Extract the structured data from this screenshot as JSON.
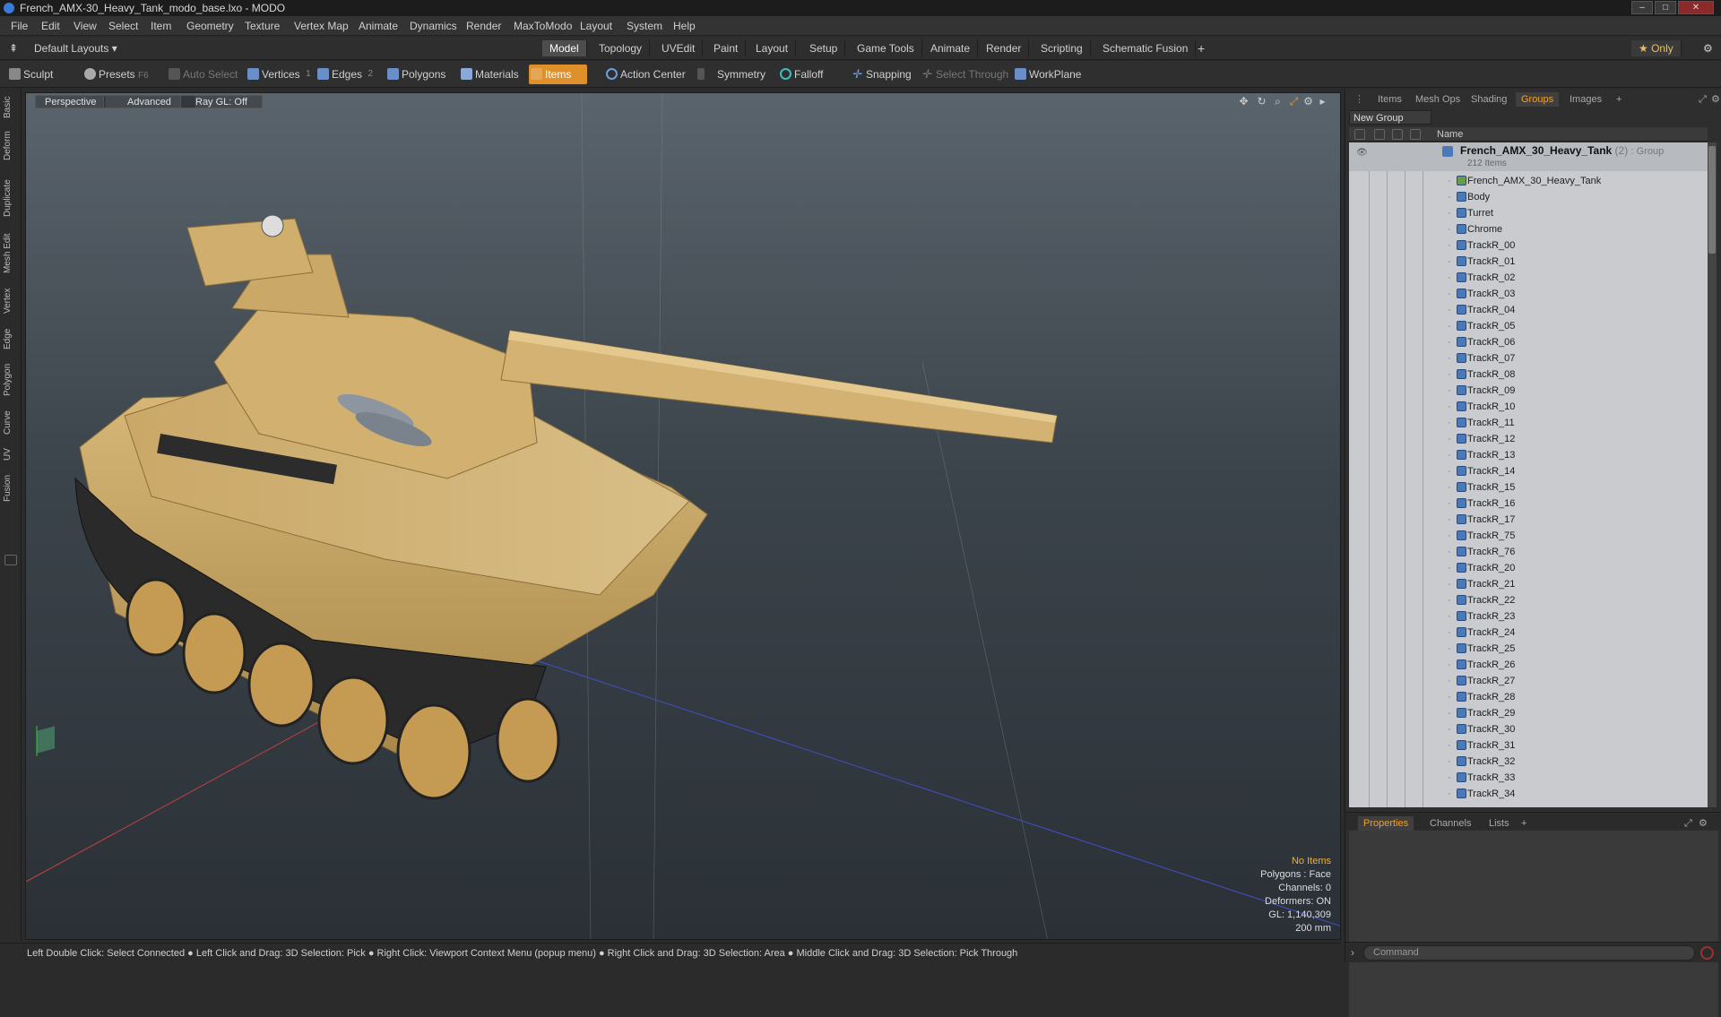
{
  "window": {
    "title": "French_AMX-30_Heavy_Tank_modo_base.lxo - MODO"
  },
  "menu": [
    "File",
    "Edit",
    "View",
    "Select",
    "Item",
    "Geometry",
    "Texture",
    "Vertex Map",
    "Animate",
    "Dynamics",
    "Render",
    "MaxToModo",
    "Layout",
    "System",
    "Help"
  ],
  "layout": {
    "selector": "Default Layouts ▾",
    "tabs": [
      "Model",
      "Topology",
      "UVEdit",
      "Paint",
      "Layout",
      "Setup",
      "Game Tools",
      "Animate",
      "Render",
      "Scripting",
      "Schematic Fusion"
    ],
    "active_tab": "Model",
    "add": "+",
    "only": "Only"
  },
  "toolbar": {
    "sculpt": "Sculpt",
    "presets": "Presets",
    "presets_key": "F6",
    "auto_select": "Auto Select",
    "vertices": "Vertices",
    "vertices_count": "1",
    "edges": "Edges",
    "edges_count": "2",
    "polygons": "Polygons",
    "materials": "Materials",
    "items": "Items",
    "action_center": "Action Center",
    "symmetry": "Symmetry",
    "falloff": "Falloff",
    "snapping": "Snapping",
    "select_through": "Select Through",
    "workplane": "WorkPlane"
  },
  "left_tabs": [
    "Basic",
    "Deform",
    "Duplicate",
    "Mesh Edit",
    "Vertex",
    "Edge",
    "Polygon",
    "Curve",
    "UV",
    "Fusion"
  ],
  "viewport": {
    "view": "Perspective",
    "shading": "Advanced",
    "raygl": "Ray GL: Off",
    "stats": {
      "items": "No Items",
      "polygons": "Polygons : Face",
      "channels": "Channels: 0",
      "deformers": "Deformers: ON",
      "gl": "GL: 1,140,309",
      "scale": "200 mm"
    }
  },
  "statusbar": "Left Double Click: Select Connected ● Left Click and Drag: 3D Selection: Pick ● Right Click: Viewport Context Menu (popup menu) ● Right Click and Drag: 3D Selection: Area ● Middle Click and Drag: 3D Selection: Pick Through",
  "right_panel": {
    "tabs": [
      "Items",
      "Mesh Ops",
      "Shading",
      "Groups",
      "Images"
    ],
    "active_tab": "Groups",
    "add": "+",
    "new_group": "New Group",
    "column_name": "Name",
    "group": {
      "name": "French_AMX_30_Heavy_Tank",
      "count": "(2)",
      "type": ": Group",
      "sub": "212 Items"
    },
    "items": [
      "French_AMX_30_Heavy_Tank",
      "Body",
      "Turret",
      "Chrome",
      "TrackR_00",
      "TrackR_01",
      "TrackR_02",
      "TrackR_03",
      "TrackR_04",
      "TrackR_05",
      "TrackR_06",
      "TrackR_07",
      "TrackR_08",
      "TrackR_09",
      "TrackR_10",
      "TrackR_11",
      "TrackR_12",
      "TrackR_13",
      "TrackR_14",
      "TrackR_15",
      "TrackR_16",
      "TrackR_17",
      "TrackR_75",
      "TrackR_76",
      "TrackR_20",
      "TrackR_21",
      "TrackR_22",
      "TrackR_23",
      "TrackR_24",
      "TrackR_25",
      "TrackR_26",
      "TrackR_27",
      "TrackR_28",
      "TrackR_29",
      "TrackR_30",
      "TrackR_31",
      "TrackR_32",
      "TrackR_33",
      "TrackR_34"
    ],
    "bottom_tabs": [
      "Properties",
      "Channels",
      "Lists"
    ],
    "bottom_active": "Properties",
    "command_placeholder": "Command"
  },
  "colors": {
    "accent": "#f0a030",
    "tank": "#c9a464",
    "track": "#2a2a2a"
  }
}
